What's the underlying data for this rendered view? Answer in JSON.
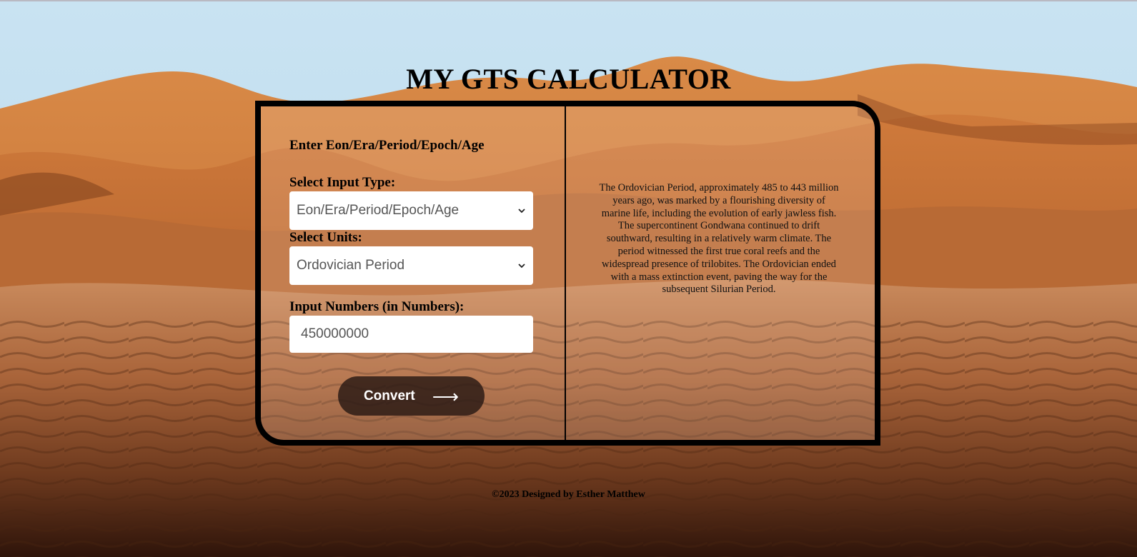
{
  "title": "MY GTS CALCULATOR",
  "form": {
    "heading": "Enter Eon/Era/Period/Epoch/Age",
    "input_type_label": "Select Input Type:",
    "input_type_value": "Eon/Era/Period/Epoch/Age",
    "units_label": "Select Units:",
    "units_value": "Ordovician Period",
    "number_label": "Input Numbers (in Numbers):",
    "number_value": "450000000",
    "convert_label": "Convert",
    "convert_arrow": "⟶"
  },
  "description": "The Ordovician Period, approximately 485 to 443 million years ago, was marked by a flourishing diversity of marine life, including the evolution of early jawless fish. The supercontinent Gondwana continued to drift southward, resulting in a relatively warm climate. The period witnessed the first true coral reefs and the widespread presence of trilobites. The Ordovician ended with a mass extinction event, paving the way for the subsequent Silurian Period.",
  "footer": "©2023 Designed by Esther Matthew",
  "icons": {
    "dropdown": "chevron-down-icon",
    "convert": "arrow-right-icon"
  },
  "colors": {
    "card_border": "#000000",
    "button_bg": "#2b1a14",
    "button_text": "#ffffff"
  }
}
